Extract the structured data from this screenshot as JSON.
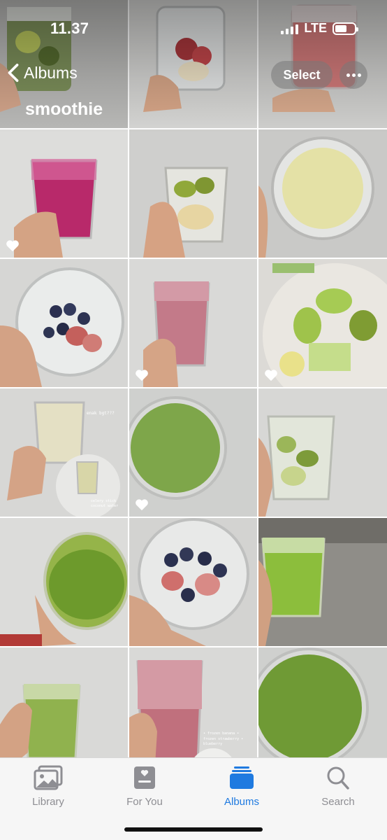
{
  "status_bar": {
    "time": "11.37",
    "network": "LTE",
    "signal_bars": 4,
    "battery_level": 0.6
  },
  "nav": {
    "back_label": "Albums",
    "select_label": "Select",
    "more_icon": "ellipsis-icon",
    "album_title": "smoothie"
  },
  "photos": [
    {
      "name": "photo-kiwi-cup",
      "favorite": false
    },
    {
      "name": "photo-strawberry-banana-cup",
      "favorite": false
    },
    {
      "name": "photo-red-smoothie",
      "favorite": false
    },
    {
      "name": "photo-dragonfruit-smoothie",
      "favorite": true
    },
    {
      "name": "photo-kiwi-banana-cup",
      "favorite": false
    },
    {
      "name": "photo-banana-smoothie-top",
      "favorite": false
    },
    {
      "name": "photo-blueberry-strawberry-cup",
      "favorite": false
    },
    {
      "name": "photo-pink-smoothie",
      "favorite": true
    },
    {
      "name": "photo-apple-kiwi-celery-plate",
      "favorite": true
    },
    {
      "name": "photo-smoothie-collage",
      "favorite": false
    },
    {
      "name": "photo-green-smoothie-top",
      "favorite": true
    },
    {
      "name": "photo-green-veg-cup",
      "favorite": false
    },
    {
      "name": "photo-green-smoothie-cup",
      "favorite": false
    },
    {
      "name": "photo-frozen-berries-cup",
      "favorite": false
    },
    {
      "name": "photo-green-smoothie-wall",
      "favorite": false
    },
    {
      "name": "photo-light-green-smoothie",
      "favorite": false
    },
    {
      "name": "photo-pink-smoothie-2",
      "favorite": false
    },
    {
      "name": "photo-green-smoothie-top-2",
      "favorite": false
    }
  ],
  "photo_annotations": {
    "collage_text_1": "enak bgt???",
    "collage_text_2": "celery stick coconut water",
    "pink_text": "• frozen banana • frozen strawberry • blueberry"
  },
  "tabbar": {
    "tabs": [
      {
        "label": "Library",
        "icon": "photo-library-icon",
        "active": false
      },
      {
        "label": "For You",
        "icon": "for-you-icon",
        "active": false
      },
      {
        "label": "Albums",
        "icon": "albums-icon",
        "active": true
      },
      {
        "label": "Search",
        "icon": "search-icon",
        "active": false
      }
    ]
  },
  "colors": {
    "accent": "#1f7ae0",
    "inactive": "#8e8e93",
    "favorite_heart": "#ffffff"
  }
}
